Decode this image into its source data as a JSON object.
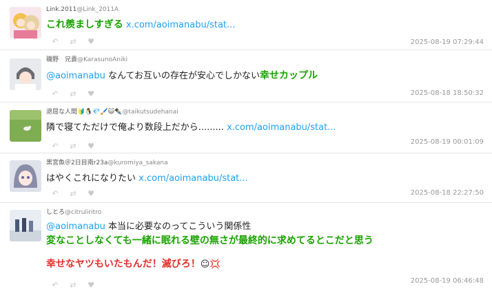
{
  "tweets": [
    {
      "name": "Link.2011",
      "handle": "@Link_2011A",
      "green": "これ羨ましすぎる",
      "link": "x.com/aoimanabu/stat...",
      "time": "2025-08-19 07:29:44"
    },
    {
      "name": "磯野　兄貴",
      "handle": "@KarasunoAniki",
      "mention": "@aoimanabu",
      "text": " なんてお互いの存在が安心でしかない",
      "green": "幸せカップル",
      "time": "2025-08-18 18:50:32"
    },
    {
      "name": "退屈な人間",
      "emojis": "🔰🐧💎🖌️😺✒️",
      "handle": "@taikutsudehanai",
      "text": "隣で寝てただけで俺より数段上だから......... ",
      "link": "x.com/aoimanabu/stat...",
      "time": "2025-08-19 00:01:09"
    },
    {
      "name": "黒宮魚＠2日目南r23a",
      "handle": "@kuromiya_sakana",
      "text": "はやくこれになりたい ",
      "link": "x.com/aoimanabu/stat...",
      "time": "2025-08-18 22:27:50"
    },
    {
      "name": "しとろ",
      "handle": "@citruliritro",
      "mention": "@aoimanabu",
      "text": " 本当に必要なのってこういう関係性",
      "green": "変なことしなくても一緒に眠れる壁の無さが最終的に求めてるとこだと思う",
      "red": "幸せなヤツもいたもんだ！滅びろ！",
      "red_emoji": "☺💢",
      "time": "2025-08-19 06:46:48"
    }
  ],
  "icons": [
    "reply-icon",
    "retweet-icon",
    "like-icon"
  ],
  "colors": {
    "link": "#1da1f2",
    "green": "#19a300",
    "red": "#e0312b",
    "timestamp": "#999999"
  }
}
